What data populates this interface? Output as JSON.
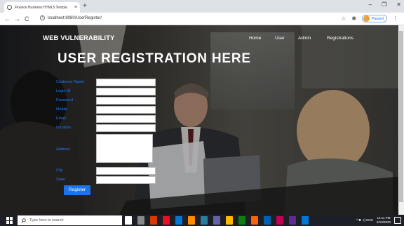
{
  "browser": {
    "tab_title": "Finance Business HTML5 Templa",
    "tab_close": "×",
    "new_tab": "+",
    "url": "localhost:8080/UserRegister/",
    "back": "←",
    "forward": "→",
    "reload": "C",
    "profile_status": "Paused",
    "window_minimize": "–",
    "window_maximize": "❐",
    "window_close": "✕",
    "star": "☆",
    "extensions": "✱",
    "menu": "⋮"
  },
  "site": {
    "brand": "WEB VULNERABILITY",
    "nav": [
      "Home",
      "User",
      "Admin",
      "Registrations"
    ],
    "heading": "USER REGISTRATION HERE"
  },
  "form": {
    "fields": [
      {
        "label": "Customer Name",
        "value": ""
      },
      {
        "label": "Login ID",
        "value": ""
      },
      {
        "label": "Password",
        "value": ""
      },
      {
        "label": "Mobile",
        "value": ""
      },
      {
        "label": "Email",
        "value": ""
      },
      {
        "label": "Location",
        "value": ""
      }
    ],
    "address_label": "Address",
    "address_value": "",
    "city_label": "City",
    "city_value": "",
    "state_label": "State",
    "state_value": "",
    "submit_label": "Register"
  },
  "taskbar": {
    "search_placeholder": "Type here to search",
    "time": "12:11 PM",
    "date": "6/10/2020",
    "tray_icons": "^ ⧉ ◁) ENG",
    "app_colors": [
      "#ffffff",
      "#888888",
      "#d83b01",
      "#e81123",
      "#0078d7",
      "#ff8c00",
      "#2d7d9a",
      "#6264a7",
      "#ffb900",
      "#107c10",
      "#f7630c",
      "#0063b1",
      "#c30052",
      "#5c2d91",
      "#0078d7"
    ]
  }
}
